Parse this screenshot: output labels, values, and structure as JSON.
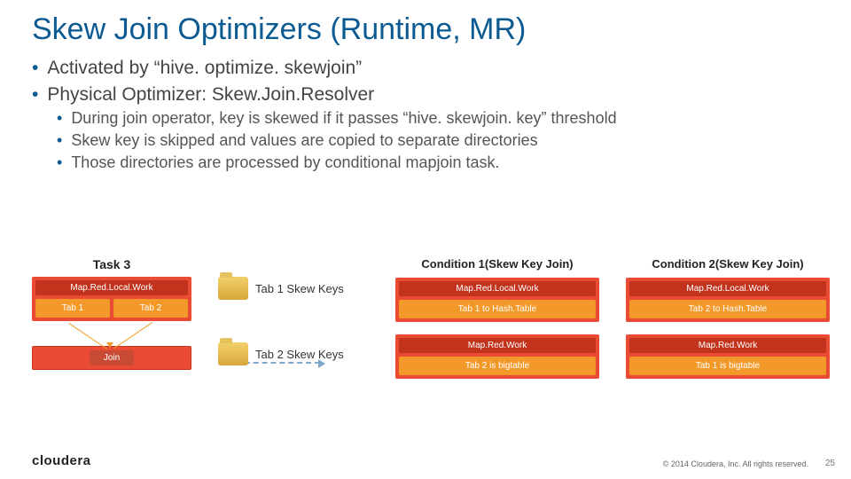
{
  "title": "Skew Join Optimizers (Runtime, MR)",
  "bullets": [
    "Activated by “hive. optimize. skewjoin”",
    "Physical Optimizer: Skew.Join.Resolver"
  ],
  "subbullets": [
    "During join operator, key is skewed if it passes “hive. skewjoin. key” threshold",
    "Skew key is skipped and values are copied to separate directories",
    "Those directories are processed by conditional mapjoin task."
  ],
  "task3": {
    "title": "Task 3",
    "mrlocal": "Map.Red.Local.Work",
    "tab1": "Tab 1",
    "tab2": "Tab 2",
    "join": "Join"
  },
  "folders": {
    "f1": "Tab 1 Skew Keys",
    "f2": "Tab 2 Skew Keys"
  },
  "cond1": {
    "title": "Condition 1(Skew Key Join)",
    "mrlocal": "Map.Red.Local.Work",
    "hash": "Tab 1 to Hash.Table",
    "mrw": "Map.Red.Work",
    "big": "Tab 2 is bigtable"
  },
  "cond2": {
    "title": "Condition 2(Skew Key Join)",
    "mrlocal": "Map.Red.Local.Work",
    "hash": "Tab 2 to Hash.Table",
    "mrw": "Map.Red.Work",
    "big": "Tab 1 is bigtable"
  },
  "footer": {
    "logo": "cloudera",
    "copyright": "© 2014 Cloudera, Inc. All rights reserved.",
    "page": "25"
  }
}
